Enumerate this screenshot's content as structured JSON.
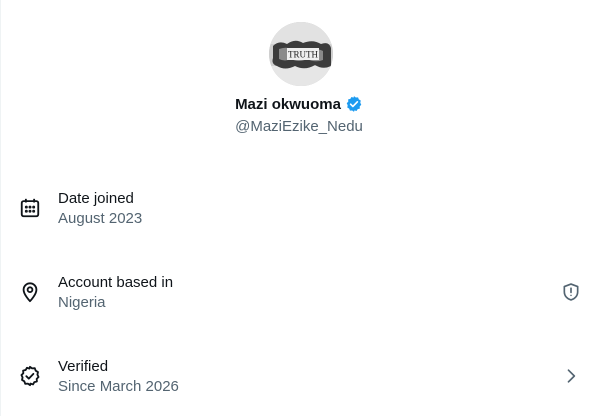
{
  "profile": {
    "avatar_text": "TRUTH",
    "display_name": "Mazi okwuoma",
    "handle": "@MaziEzike_Nedu"
  },
  "about": {
    "date_joined": {
      "title": "Date joined",
      "value": "August 2023"
    },
    "account_based_in": {
      "title": "Account based in",
      "value": "Nigeria"
    },
    "verified": {
      "title": "Verified",
      "value": "Since March 2026"
    }
  },
  "icons": {
    "calendar": "calendar-icon",
    "location": "location-pin-icon",
    "verified": "verified-badge-icon",
    "shield": "shield-alert-icon",
    "chevron": "chevron-right-icon"
  },
  "colors": {
    "primary_text": "#0f1419",
    "secondary_text": "#536471",
    "verified_blue": "#1d9bf0"
  }
}
